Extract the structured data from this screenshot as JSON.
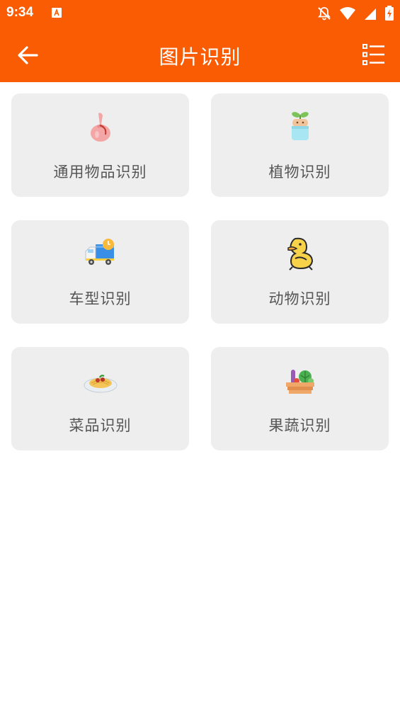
{
  "status_bar": {
    "time": "9:34"
  },
  "app_bar": {
    "title": "图片识别"
  },
  "colors": {
    "primary": "#f95c02",
    "card_bg": "#eeeeee",
    "label_text": "#555555"
  },
  "categories": [
    {
      "label": "通用物品识别",
      "icon": "pouch-icon"
    },
    {
      "label": "植物识别",
      "icon": "sprout-pot-icon"
    },
    {
      "label": "车型识别",
      "icon": "truck-icon"
    },
    {
      "label": "动物识别",
      "icon": "duck-icon"
    },
    {
      "label": "菜品识别",
      "icon": "pasta-plate-icon"
    },
    {
      "label": "果蔬识别",
      "icon": "vegetable-basket-icon"
    }
  ]
}
